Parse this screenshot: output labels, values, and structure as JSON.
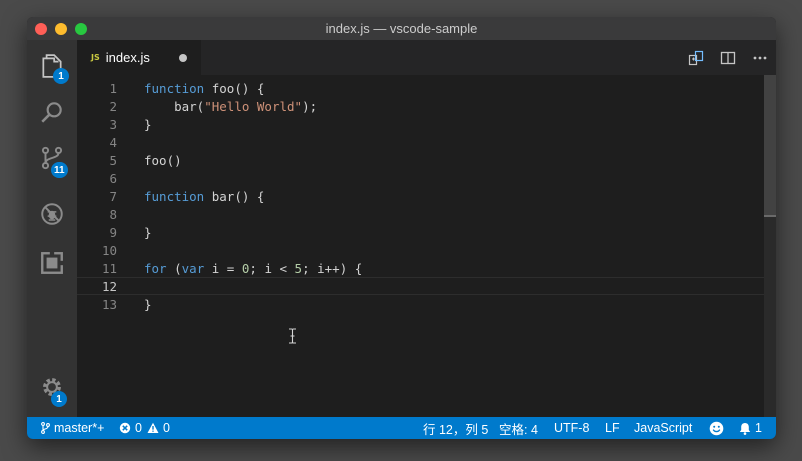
{
  "window": {
    "title": "index.js — vscode-sample"
  },
  "activity": {
    "explorer_badge": "1",
    "scm_badge": "11",
    "settings_badge": "1"
  },
  "tab": {
    "icon_text": "JS",
    "label": "index.js"
  },
  "editor": {
    "lines": [
      {
        "num": "1"
      },
      {
        "num": "2"
      },
      {
        "num": "3"
      },
      {
        "num": "4"
      },
      {
        "num": "5"
      },
      {
        "num": "6"
      },
      {
        "num": "7"
      },
      {
        "num": "8"
      },
      {
        "num": "9"
      },
      {
        "num": "10"
      },
      {
        "num": "11"
      },
      {
        "num": "12"
      },
      {
        "num": "13"
      }
    ],
    "tokens": {
      "l1_kw": "function",
      "l1_rest": " foo() {",
      "l2_a": "    bar(",
      "l2_str": "\"Hello World\"",
      "l2_b": ");",
      "l3": "}",
      "l5": "foo()",
      "l7_kw": "function",
      "l7_rest": " bar() {",
      "l9": "}",
      "l11_kw1": "for",
      "l11_a": " (",
      "l11_kw2": "var",
      "l11_b": " i = ",
      "l11_n1": "0",
      "l11_c": "; i < ",
      "l11_n2": "5",
      "l11_d": "; i++) {",
      "l13": "}"
    }
  },
  "status": {
    "branch": "master*+",
    "errors": "0",
    "warnings": "0",
    "position": "行 12，列 5",
    "indent": "空格: 4",
    "encoding": "UTF-8",
    "eol": "LF",
    "language": "JavaScript",
    "notifications": "1"
  },
  "colors": {
    "accent": "#007acc",
    "keyword": "#569cd6",
    "string": "#ce9178",
    "number": "#b5cea8"
  },
  "icons": {
    "activity": [
      "files-icon",
      "search-icon",
      "source-control-icon",
      "debug-icon",
      "extensions-icon",
      "gear-icon"
    ],
    "tab_actions": [
      "compare-changes-icon",
      "split-editor-icon",
      "more-icon"
    ],
    "status": [
      "branch-icon",
      "error-icon",
      "warning-icon",
      "smiley-icon",
      "bell-icon"
    ]
  }
}
